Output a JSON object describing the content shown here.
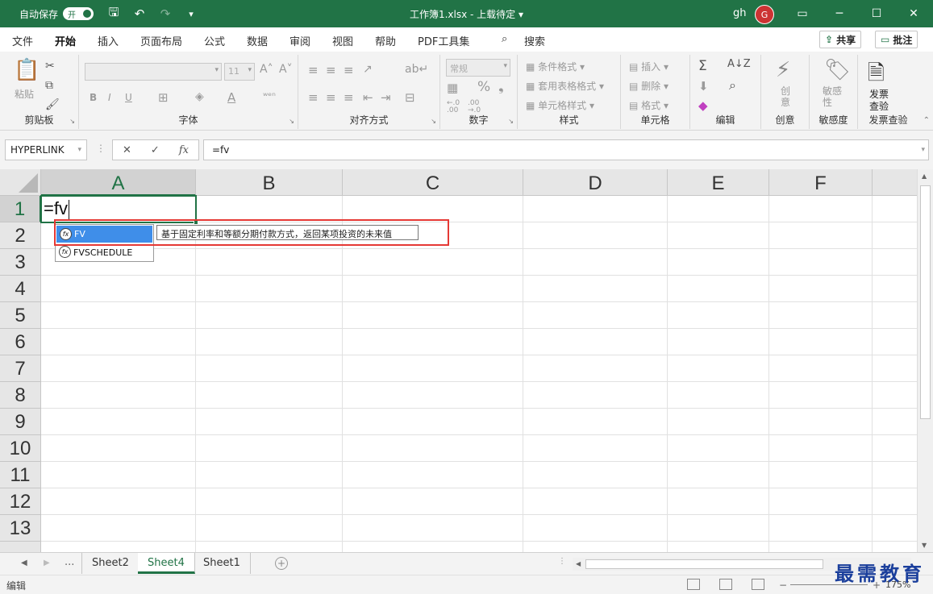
{
  "titlebar": {
    "autosave_label": "自动保存",
    "autosave_state": "开",
    "doc_title": "工作簿1.xlsx - 上载待定 ▾",
    "user": "gh",
    "avatar": "G",
    "bg_color": "#217346"
  },
  "menu": {
    "tabs": [
      "文件",
      "开始",
      "插入",
      "页面布局",
      "公式",
      "数据",
      "审阅",
      "视图",
      "帮助",
      "PDF工具集"
    ],
    "active_tab": "开始",
    "search_label": "搜索",
    "share_label": "共享",
    "comment_label": "批注"
  },
  "ribbon": {
    "groups": {
      "clipboard": "剪贴板",
      "font": "字体",
      "alignment": "对齐方式",
      "number": "数字",
      "styles": "样式",
      "cells": "单元格",
      "editing": "编辑",
      "creative": "创意",
      "sensitivity": "敏感度",
      "invoice": "发票查验"
    },
    "paste_label": "粘贴",
    "font_size_value": "11",
    "number_format": "常规",
    "conditional_format": "条件格式",
    "table_format": "套用表格格式",
    "cell_styles": "单元格样式",
    "insert": "插入",
    "delete": "删除",
    "format": "格式",
    "creative_btn": "创\n意",
    "sensitivity_btn": "敏感\n性",
    "invoice_btn_line1": "发票",
    "invoice_btn_line2": "查验",
    "pct": "%",
    "comma": "❟",
    "dec_inc": "←.0\n.00",
    "dec_dec": ".00\n→.0"
  },
  "formula_bar": {
    "name_box": "HYPERLINK",
    "cancel_icon": "✕",
    "enter_icon": "✓",
    "fx": "fx",
    "formula": "=fv"
  },
  "grid": {
    "columns": [
      "A",
      "B",
      "C",
      "D",
      "E",
      "F"
    ],
    "rows": [
      "1",
      "2",
      "3",
      "4",
      "5",
      "6",
      "7",
      "8",
      "9",
      "10",
      "11",
      "12",
      "13"
    ],
    "active_cell_text": "=fv",
    "active_col": "A",
    "active_row": "1"
  },
  "autocomplete": {
    "items": [
      "FV",
      "FVSCHEDULE"
    ],
    "selected": "FV",
    "tooltip": "基于固定利率和等额分期付款方式，返回某项投资的未来值",
    "highlight_color": "#e53935"
  },
  "sheets": {
    "ellipsis": "...",
    "tabs": [
      "Sheet2",
      "Sheet4",
      "Sheet1"
    ],
    "active": "Sheet4"
  },
  "status": {
    "mode": "编辑",
    "zoom": "175%"
  },
  "watermark": "最需教育"
}
